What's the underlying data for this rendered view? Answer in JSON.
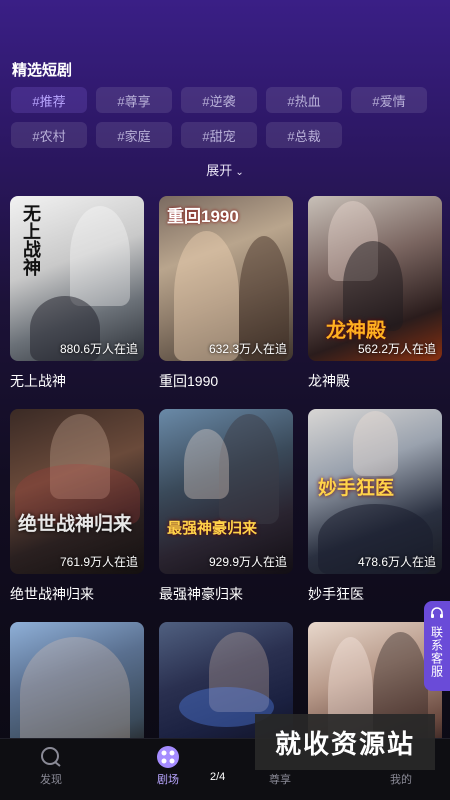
{
  "header": {
    "title": "精选短剧"
  },
  "tags": {
    "row1": [
      "#推荐",
      "#尊享",
      "#逆袭",
      "#热血",
      "#爱情"
    ],
    "row2": [
      "#农村",
      "#家庭",
      "#甜宠",
      "#总裁"
    ],
    "active": "#推荐"
  },
  "expand_label": "展开",
  "dramas": [
    {
      "name": "无上战神",
      "watching": "880.6万人在追",
      "poster_text": "无上战神"
    },
    {
      "name": "重回1990",
      "watching": "632.3万人在追",
      "poster_text": "重回1990"
    },
    {
      "name": "龙神殿",
      "watching": "562.2万人在追",
      "poster_text": "龙神殿"
    },
    {
      "name": "绝世战神归来",
      "watching": "761.9万人在追",
      "poster_text": "绝世战神归来"
    },
    {
      "name": "最强神豪归来",
      "watching": "929.9万人在追",
      "poster_text": "最强神豪归来"
    },
    {
      "name": "妙手狂医",
      "watching": "478.6万人在追",
      "poster_text": "妙手狂医"
    }
  ],
  "contact": {
    "label": "联系客服"
  },
  "tabbar": {
    "items": [
      {
        "label": "发现",
        "icon": "discover-icon"
      },
      {
        "label": "剧场",
        "icon": "theater-icon"
      },
      {
        "label": "尊享",
        "icon": "vip-icon"
      },
      {
        "label": "我的",
        "icon": "profile-icon"
      }
    ],
    "active": "剧场"
  },
  "pager": "2/4",
  "watermark": "就收资源站"
}
